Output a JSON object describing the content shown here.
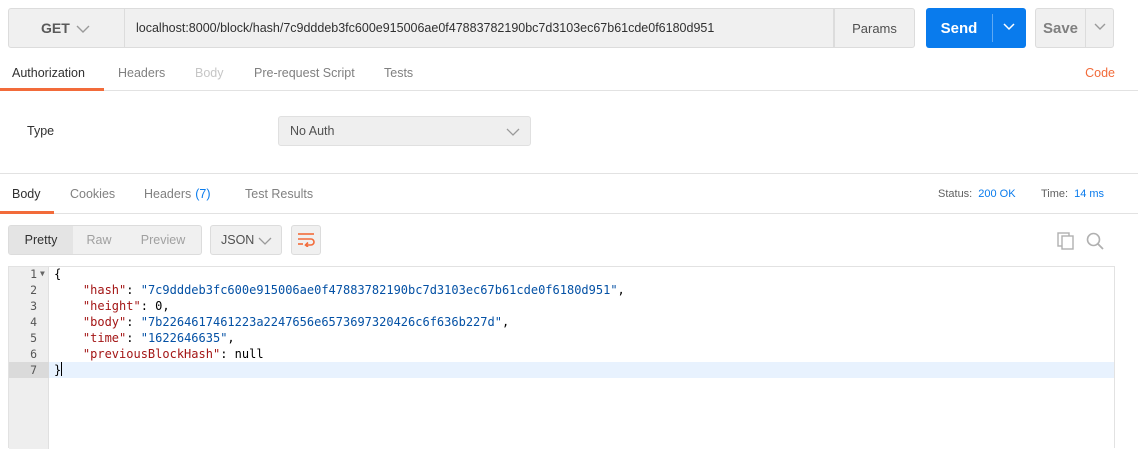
{
  "request": {
    "method": "GET",
    "url": "localhost:8000/block/hash/7c9dddeb3fc600e915006ae0f47883782190bc7d3103ec67b61cde0f6180d951",
    "params_label": "Params",
    "send_label": "Send",
    "save_label": "Save"
  },
  "request_tabs": {
    "authorization": "Authorization",
    "headers": "Headers",
    "body": "Body",
    "prerequest": "Pre-request Script",
    "tests": "Tests",
    "code": "Code"
  },
  "auth": {
    "type_label": "Type",
    "type_value": "No Auth"
  },
  "response_tabs": {
    "body": "Body",
    "cookies": "Cookies",
    "headers": "Headers",
    "headers_count": "(7)",
    "test_results": "Test Results"
  },
  "status": {
    "status_label": "Status:",
    "status_value": "200 OK",
    "time_label": "Time:",
    "time_value": "14 ms"
  },
  "view": {
    "pretty": "Pretty",
    "raw": "Raw",
    "preview": "Preview",
    "format": "JSON"
  },
  "response_body": {
    "line_numbers": [
      "1",
      "2",
      "3",
      "4",
      "5",
      "6",
      "7"
    ],
    "open_brace": "{",
    "close_brace": "}",
    "hash_key": "\"hash\"",
    "hash_value": "\"7c9dddeb3fc600e915006ae0f47883782190bc7d3103ec67b61cde0f6180d951\"",
    "height_key": "\"height\"",
    "height_value": "0",
    "body_key": "\"body\"",
    "body_value": "\"7b2264617461223a2247656e6573697320426c6f636b227d\"",
    "time_key": "\"time\"",
    "time_value": "\"1622646635\"",
    "prev_key": "\"previousBlockHash\"",
    "prev_value": "null"
  },
  "colors": {
    "accent": "#f26b3a",
    "send": "#097bed",
    "json_key": "#a31515",
    "json_string": "#0451a5"
  }
}
